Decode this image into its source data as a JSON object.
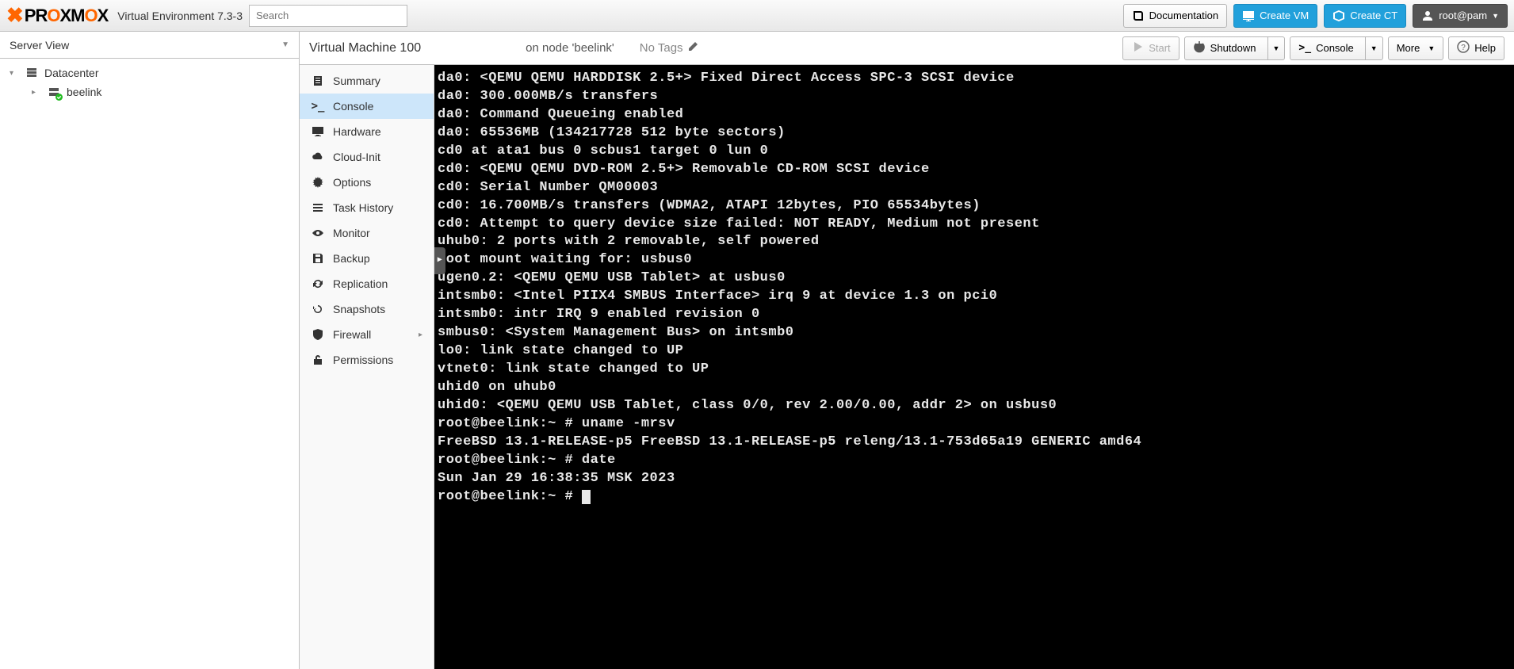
{
  "header": {
    "logo_text": "PROXMOX",
    "product": "Virtual Environment 7.3-3",
    "search_placeholder": "Search",
    "documentation": "Documentation",
    "create_vm": "Create VM",
    "create_ct": "Create CT",
    "user": "root@pam"
  },
  "server_view": {
    "label": "Server View",
    "tree": {
      "root": "Datacenter",
      "node": "beelink"
    }
  },
  "vm": {
    "title": "Virtual Machine 100",
    "node_text": "on node 'beelink'",
    "no_tags": "No Tags",
    "buttons": {
      "start": "Start",
      "shutdown": "Shutdown",
      "console": "Console",
      "more": "More",
      "help": "Help"
    }
  },
  "sidemenu": {
    "summary": "Summary",
    "console": "Console",
    "hardware": "Hardware",
    "cloudinit": "Cloud-Init",
    "options": "Options",
    "taskhistory": "Task History",
    "monitor": "Monitor",
    "backup": "Backup",
    "replication": "Replication",
    "snapshots": "Snapshots",
    "firewall": "Firewall",
    "permissions": "Permissions"
  },
  "console_lines": [
    "da0: <QEMU QEMU HARDDISK 2.5+> Fixed Direct Access SPC-3 SCSI device",
    "da0: 300.000MB/s transfers",
    "da0: Command Queueing enabled",
    "da0: 65536MB (134217728 512 byte sectors)",
    "cd0 at ata1 bus 0 scbus1 target 0 lun 0",
    "cd0: <QEMU QEMU DVD-ROM 2.5+> Removable CD-ROM SCSI device",
    "cd0: Serial Number QM00003",
    "cd0: 16.700MB/s transfers (WDMA2, ATAPI 12bytes, PIO 65534bytes)",
    "cd0: Attempt to query device size failed: NOT READY, Medium not present",
    "uhub0: 2 ports with 2 removable, self powered",
    "Root mount waiting for: usbus0",
    "ugen0.2: <QEMU QEMU USB Tablet> at usbus0",
    "intsmb0: <Intel PIIX4 SMBUS Interface> irq 9 at device 1.3 on pci0",
    "intsmb0: intr IRQ 9 enabled revision 0",
    "smbus0: <System Management Bus> on intsmb0",
    "lo0: link state changed to UP",
    "vtnet0: link state changed to UP",
    "uhid0 on uhub0",
    "uhid0: <QEMU QEMU USB Tablet, class 0/0, rev 2.00/0.00, addr 2> on usbus0",
    "root@beelink:~ # uname -mrsv",
    "FreeBSD 13.1-RELEASE-p5 FreeBSD 13.1-RELEASE-p5 releng/13.1-753d65a19 GENERIC amd64",
    "root@beelink:~ # date",
    "Sun Jan 29 16:38:35 MSK 2023",
    "root@beelink:~ # "
  ]
}
